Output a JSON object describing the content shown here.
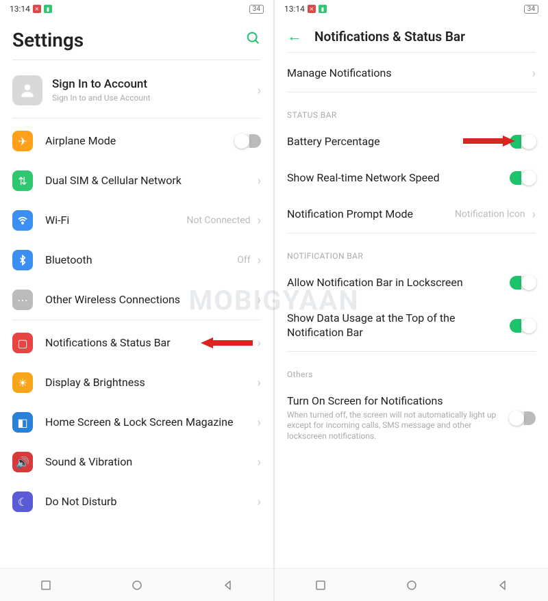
{
  "statusbar": {
    "time": "13:14",
    "battery": "34"
  },
  "left": {
    "title": "Settings",
    "account": {
      "title": "Sign In to Account",
      "sub": "Sign In to and Use Account"
    },
    "items": [
      {
        "label": "Airplane Mode",
        "iconClass": "ic-orange"
      },
      {
        "label": "Dual SIM & Cellular Network",
        "iconClass": "ic-green"
      },
      {
        "label": "Wi-Fi",
        "meta": "Not Connected",
        "iconClass": "ic-blue"
      },
      {
        "label": "Bluetooth",
        "meta": "Off",
        "iconClass": "ic-blue"
      },
      {
        "label": "Other Wireless Connections",
        "iconClass": "ic-gray"
      },
      {
        "label": "Notifications & Status Bar",
        "iconClass": "ic-red"
      },
      {
        "label": "Display & Brightness",
        "iconClass": "ic-amber"
      },
      {
        "label": "Home Screen & Lock Screen Magazine",
        "iconClass": "ic-teal"
      },
      {
        "label": "Sound & Vibration",
        "iconClass": "ic-crimson"
      },
      {
        "label": "Do Not Disturb",
        "iconClass": "ic-purple"
      }
    ]
  },
  "right": {
    "title": "Notifications & Status Bar",
    "manage": "Manage Notifications",
    "sec1": "STATUS BAR",
    "battPct": "Battery Percentage",
    "netSpeed": "Show Real-time Network Speed",
    "promptMode": {
      "label": "Notification Prompt Mode",
      "value": "Notification Icon"
    },
    "sec2": "NOTIFICATION BAR",
    "allowLock": "Allow Notification Bar in Lockscreen",
    "dataUsage": "Show Data Usage at the Top of the Notification Bar",
    "sec3": "Others",
    "turnOn": {
      "label": "Turn On Screen for Notifications",
      "sub": "When turned off, the screen will not automatically light up except for incoming calls, SMS message and other lockscreen notifications."
    }
  },
  "watermark": "MOBIGYAAN"
}
